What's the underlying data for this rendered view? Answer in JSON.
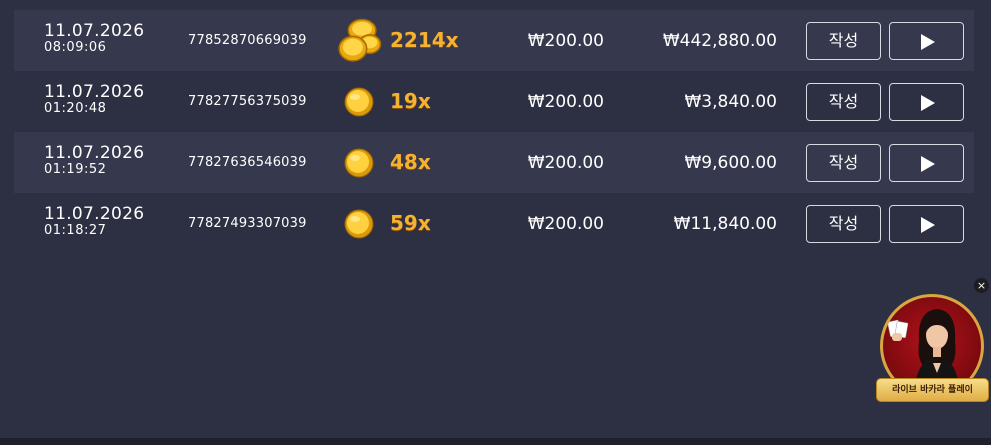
{
  "rows": [
    {
      "date": "11.07.2026",
      "time": "08:09:06",
      "id": "77852870669039",
      "coin": "coin-stack",
      "multiplier": "2214x",
      "bet": "₩200.00",
      "win": "₩442,880.00",
      "write_label": "작성"
    },
    {
      "date": "11.07.2026",
      "time": "01:20:48",
      "id": "77827756375039",
      "coin": "coin",
      "multiplier": "19x",
      "bet": "₩200.00",
      "win": "₩3,840.00",
      "write_label": "작성"
    },
    {
      "date": "11.07.2026",
      "time": "01:19:52",
      "id": "77827636546039",
      "coin": "coin",
      "multiplier": "48x",
      "bet": "₩200.00",
      "win": "₩9,600.00",
      "write_label": "작성"
    },
    {
      "date": "11.07.2026",
      "time": "01:18:27",
      "id": "77827493307039",
      "coin": "coin",
      "multiplier": "59x",
      "bet": "₩200.00",
      "win": "₩11,840.00",
      "write_label": "작성"
    }
  ],
  "promo": {
    "label": "라이브 바카라 플레이",
    "close": "×"
  },
  "colors": {
    "background": "#2d2f43",
    "stripe": "#36384d",
    "multiplier": "#f5b232",
    "accent_gold": "#d9a640"
  }
}
